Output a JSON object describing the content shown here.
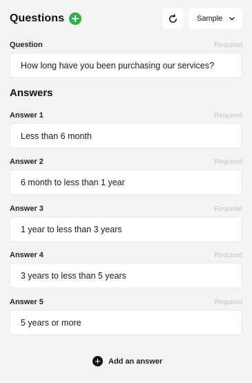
{
  "header": {
    "title": "Questions",
    "sample_label": "Sample"
  },
  "question": {
    "label": "Question",
    "required": "Required",
    "value": "How long have you been purchasing our services?"
  },
  "answers_title": "Answers",
  "answers": [
    {
      "label": "Answer 1",
      "required": "Required",
      "value": "Less than 6 month"
    },
    {
      "label": "Answer 2",
      "required": "Required",
      "value": "6 month to less than 1 year"
    },
    {
      "label": "Answer 3",
      "required": "Required",
      "value": "1 year to less than 3 years"
    },
    {
      "label": "Answer 4",
      "required": "Required",
      "value": "3 years to less than 5 years"
    },
    {
      "label": "Answer 5",
      "required": "Required",
      "value": "5 years or more"
    }
  ],
  "add_answer_label": "Add an answer",
  "colors": {
    "accent_green": "#2db34a",
    "required_gray": "#c4c4c4",
    "background": "#f4f4f4"
  }
}
